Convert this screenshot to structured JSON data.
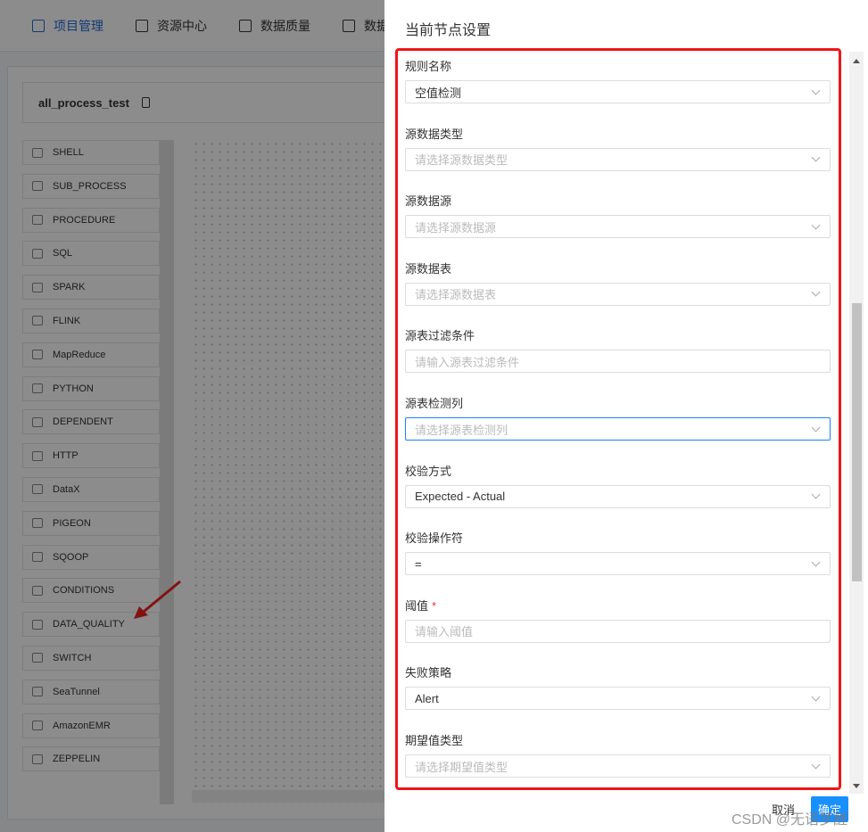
{
  "nav": [
    {
      "label": "项目管理",
      "icon": "project-icon",
      "active": true
    },
    {
      "label": "资源中心",
      "icon": "folder-icon"
    },
    {
      "label": "数据质量",
      "icon": "document-icon"
    },
    {
      "label": "数据",
      "icon": "datasource-icon"
    }
  ],
  "workflow": {
    "name": "all_process_test",
    "copy_icon": "copy-icon"
  },
  "tasks": [
    "SHELL",
    "SUB_PROCESS",
    "PROCEDURE",
    "SQL",
    "SPARK",
    "FLINK",
    "MapReduce",
    "PYTHON",
    "DEPENDENT",
    "HTTP",
    "DataX",
    "PIGEON",
    "SQOOP",
    "CONDITIONS",
    "DATA_QUALITY",
    "SWITCH",
    "SeaTunnel",
    "AmazonEMR",
    "ZEPPELIN"
  ],
  "drawer": {
    "title": "当前节点设置",
    "fields": [
      {
        "label": "规则名称",
        "value": "空值检测"
      },
      {
        "label": "源数据类型",
        "placeholder": "请选择源数据类型"
      },
      {
        "label": "源数据源",
        "placeholder": "请选择源数据源"
      },
      {
        "label": "源数据表",
        "placeholder": "请选择源数据表"
      },
      {
        "label": "源表过滤条件",
        "placeholder": "请输入源表过滤条件",
        "input": true
      },
      {
        "label": "源表检测列",
        "placeholder": "请选择源表检测列",
        "focus": true
      },
      {
        "label": "校验方式",
        "value": "Expected - Actual"
      },
      {
        "label": "校验操作符",
        "value": "="
      },
      {
        "label": "阈值",
        "placeholder": "请输入阈值",
        "input": true,
        "required": true
      },
      {
        "label": "失败策略",
        "value": "Alert"
      },
      {
        "label": "期望值类型",
        "placeholder": "请选择期望值类型"
      }
    ],
    "cancel": "取消",
    "confirm": "确定"
  },
  "watermark": "CSDN @无语梦醒",
  "colors": {
    "accent": "#1890ff",
    "highlight_box": "#f01616"
  }
}
